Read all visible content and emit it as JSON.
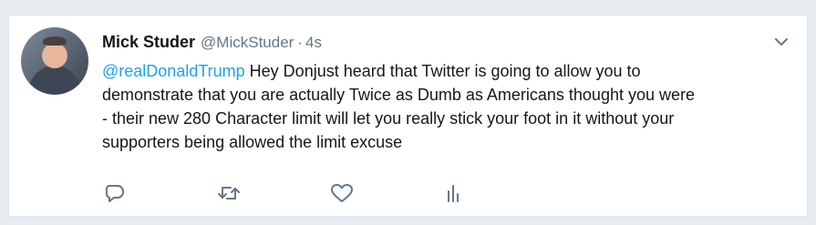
{
  "tweet": {
    "display_name": "Mick Studer",
    "handle": "@MickStuder",
    "separator": "·",
    "time": "4s",
    "mention": "@realDonaldTrump",
    "text_line1_rest": " Hey Donjust heard that Twitter is going to allow you to",
    "text_line2": "demonstrate that you are actually Twice as Dumb as Americans thought you were",
    "text_line3": "- their new 280 Character limit will let you really stick your foot in it without your",
    "text_line4": "supporters being allowed the limit excuse"
  },
  "icons": {
    "reply": "reply-icon",
    "retweet": "retweet-icon",
    "like": "heart-icon",
    "analytics": "analytics-icon",
    "menu": "chevron-down-icon"
  },
  "colors": {
    "link": "#1da1f2",
    "text": "#14171a",
    "muted": "#657786",
    "icon": "#657786",
    "background": "#e6ecf0"
  }
}
